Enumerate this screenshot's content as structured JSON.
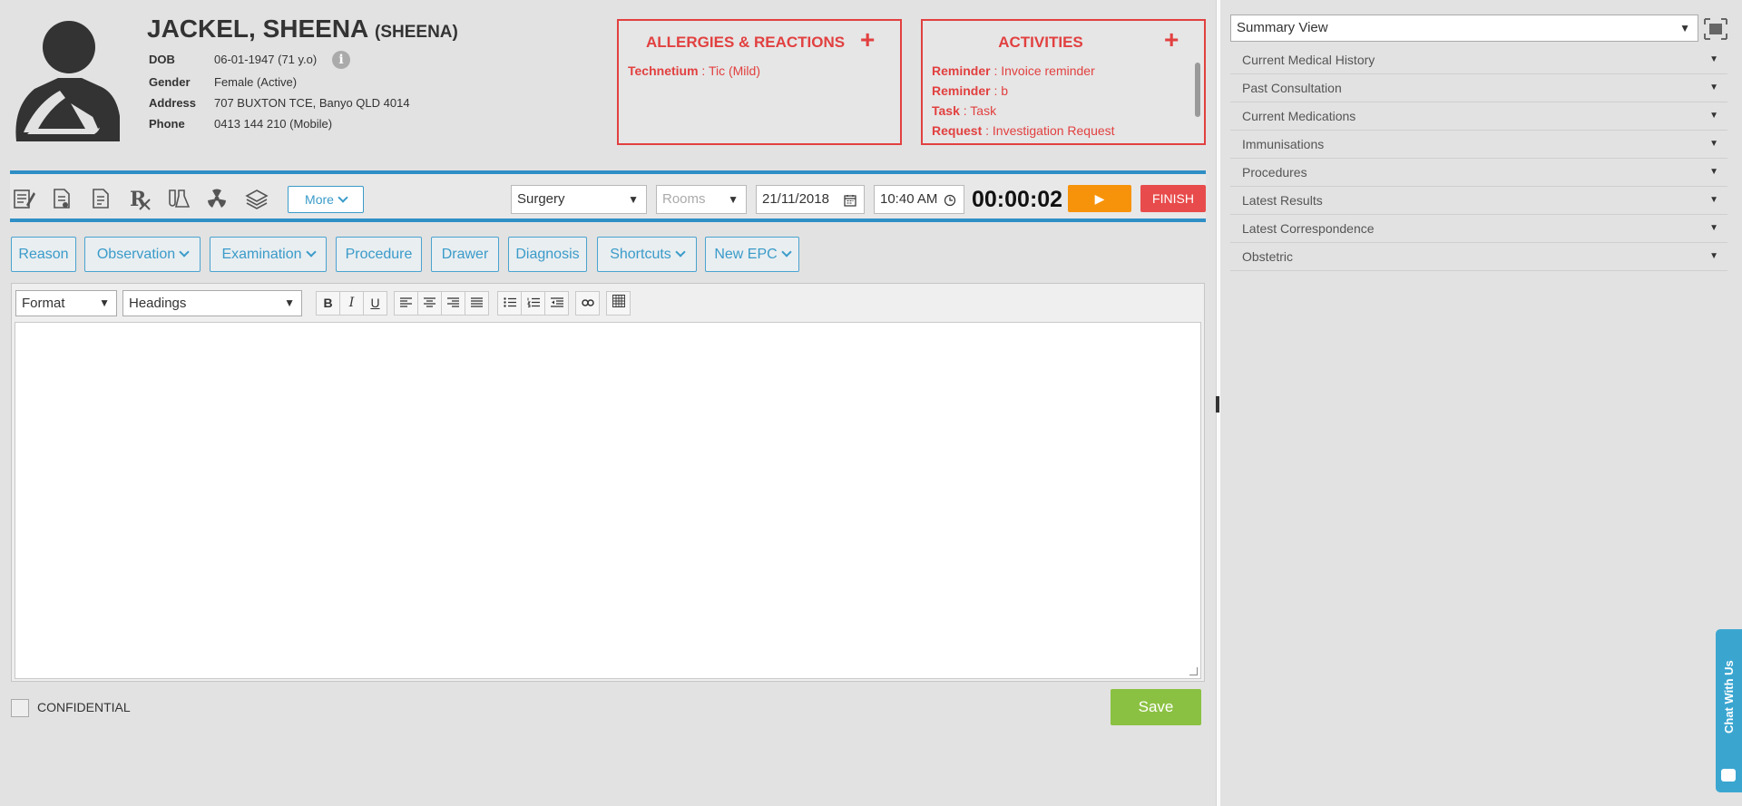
{
  "patient": {
    "name": "JACKEL, SHEENA",
    "preferred": "(SHEENA)",
    "details": [
      {
        "label": "DOB",
        "value": "06-01-1947 (71 y.o)"
      },
      {
        "label": "Gender",
        "value": "Female (Active)"
      },
      {
        "label": "Address",
        "value": "707 BUXTON TCE, Banyo QLD 4014"
      },
      {
        "label": "Phone",
        "value": "0413 144 210 (Mobile)"
      }
    ]
  },
  "allergies": {
    "title": "ALLERGIES & REACTIONS",
    "items": [
      {
        "key": "Technetium",
        "value": "Tic (Mild)"
      }
    ]
  },
  "activities": {
    "title": "ACTIVITIES",
    "items": [
      {
        "key": "Reminder",
        "value": "Invoice reminder"
      },
      {
        "key": "Reminder",
        "value": "b"
      },
      {
        "key": "Task",
        "value": "Task"
      },
      {
        "key": "Request",
        "value": "Investigation Request"
      }
    ]
  },
  "toolbar": {
    "icons": [
      "notes-icon",
      "document-icon",
      "report-icon",
      "prescription-icon",
      "lab-icon",
      "radiation-icon",
      "layers-icon"
    ],
    "more_label": "More",
    "location": "Surgery",
    "rooms_placeholder": "Rooms",
    "date": "21/11/2018",
    "time": "10:40 AM",
    "timer": "00:00:02",
    "finish_label": "FINISH"
  },
  "sections": [
    {
      "label": "Reason",
      "dropdown": false
    },
    {
      "label": "Observation",
      "dropdown": true
    },
    {
      "label": "Examination",
      "dropdown": true
    },
    {
      "label": "Procedure",
      "dropdown": false
    },
    {
      "label": "Drawer",
      "dropdown": false
    },
    {
      "label": "Diagnosis",
      "dropdown": false
    },
    {
      "label": "Shortcuts",
      "dropdown": true
    },
    {
      "label": "New EPC",
      "dropdown": true
    }
  ],
  "editor": {
    "format_label": "Format",
    "headings_label": "Headings"
  },
  "confidential_label": "CONFIDENTIAL",
  "save_label": "Save",
  "sidebar": {
    "view": "Summary View",
    "items": [
      "Current Medical History",
      "Past Consultation",
      "Current Medications",
      "Immunisations",
      "Procedures",
      "Latest Results",
      "Latest Correspondence",
      "Obstetric"
    ]
  },
  "chat_label": "Chat With Us",
  "colors": {
    "accent": "#2f8fc5",
    "alert": "#e24040",
    "play": "#f7930a",
    "finish": "#e84b4b",
    "save": "#8bc142"
  }
}
